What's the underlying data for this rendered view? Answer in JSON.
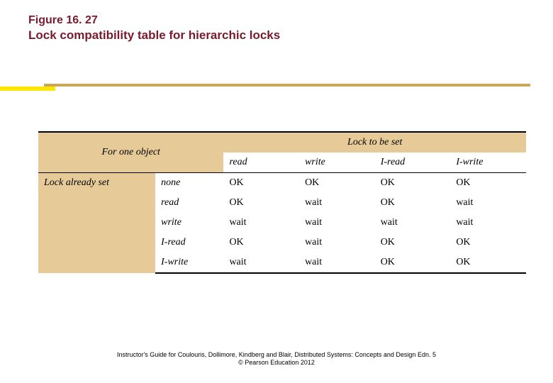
{
  "figure": {
    "number": "Figure 16. 27",
    "title": "Lock compatibility table for hierarchic locks"
  },
  "chart_data": {
    "type": "table",
    "caption_top_left": "For one object",
    "caption_top_right": "Lock to be set",
    "row_label": "Lock already set",
    "columns": [
      "read",
      "write",
      "I-read",
      "I-write"
    ],
    "rows": [
      {
        "type": "none",
        "cells": [
          "OK",
          "OK",
          "OK",
          "OK"
        ]
      },
      {
        "type": "read",
        "cells": [
          "OK",
          "wait",
          "OK",
          "wait"
        ]
      },
      {
        "type": "write",
        "cells": [
          "wait",
          "wait",
          "wait",
          "wait"
        ]
      },
      {
        "type": "I-read",
        "cells": [
          "OK",
          "wait",
          "OK",
          "OK"
        ]
      },
      {
        "type": "I-write",
        "cells": [
          "wait",
          "wait",
          "OK",
          "OK"
        ]
      }
    ]
  },
  "footer": {
    "line1": "Instructor's Guide for Coulouris, Dollimore, Kindberg and Blair, Distributed Systems: Concepts and Design Edn. 5",
    "line2": "© Pearson Education 2012"
  }
}
